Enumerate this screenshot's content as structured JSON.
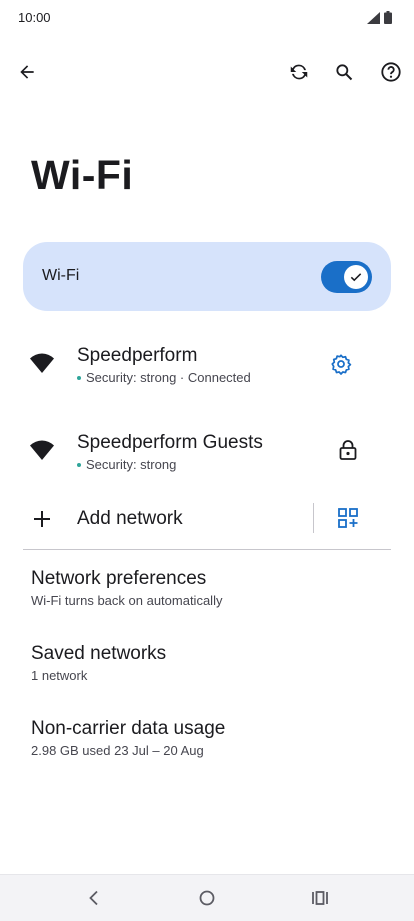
{
  "status_bar": {
    "time": "10:00"
  },
  "page": {
    "title": "Wi-Fi"
  },
  "wifi_toggle": {
    "label": "Wi-Fi",
    "state": "on"
  },
  "networks": [
    {
      "name": "Speedperform",
      "status": "Security: strong · Connected",
      "action_icon": "gear-icon"
    },
    {
      "name": "Speedperform Guests",
      "status": "Security: strong",
      "action_icon": "lock-icon"
    }
  ],
  "add_network": {
    "label": "Add network"
  },
  "preferences": [
    {
      "title": "Network preferences",
      "subtitle": "Wi-Fi turns back on automatically"
    },
    {
      "title": "Saved networks",
      "subtitle": "1 network"
    },
    {
      "title": "Non-carrier data usage",
      "subtitle": "2.98 GB used 23 Jul – 20 Aug"
    }
  ],
  "colors": {
    "accent": "#1a6fc8",
    "card": "#d6e3fb",
    "status_dot": "#2fa59a"
  }
}
